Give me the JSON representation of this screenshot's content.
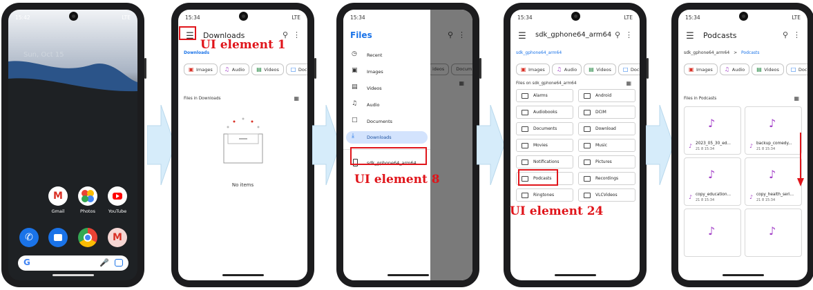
{
  "colors": {
    "annotation": "#e0141a",
    "accent": "#1a73e8",
    "music": "#a13dc7",
    "arrow": "#d6ecfa"
  },
  "phone1": {
    "time": "15:42",
    "signal": "LTE",
    "date": "Sun, Oct 15",
    "apps": [
      "Gmail",
      "Photos",
      "YouTube"
    ]
  },
  "phone2": {
    "time": "15:34",
    "signal": "LTE",
    "title": "Downloads",
    "breadcrumb": "Downloads",
    "chips": [
      "Images",
      "Audio",
      "Videos",
      "Docum"
    ],
    "section": "Files in Downloads",
    "empty": "No items",
    "annotation": "UI element 1"
  },
  "phone3": {
    "time": "15:34",
    "signal": "LTE",
    "drawer_title": "Files",
    "drawer_items": [
      "Recent",
      "Images",
      "Videos",
      "Audio",
      "Documents",
      "Downloads"
    ],
    "device": "sdk_gphone64_arm64",
    "bg_chips": [
      "ideos",
      "Docum"
    ],
    "annotation": "UI element 8"
  },
  "phone4": {
    "time": "15:34",
    "signal": "LTE",
    "title": "sdk_gphone64_arm64",
    "breadcrumb": "sdk_gphone64_arm64",
    "chips": [
      "Images",
      "Audio",
      "Videos",
      "Docum"
    ],
    "section": "Files on sdk_gphone64_arm64",
    "folders": [
      "Alarms",
      "Android",
      "Audiobooks",
      "DCIM",
      "Documents",
      "Download",
      "Movies",
      "Music",
      "Notifications",
      "Pictures",
      "Podcasts",
      "Recordings",
      "Ringtones",
      "VLCVideos"
    ],
    "annotation": "UI element 24"
  },
  "phone5": {
    "time": "15:34",
    "signal": "LTE",
    "title": "Podcasts",
    "crumb_root": "sdk_gphone64_arm64",
    "crumb_sep": ">",
    "crumb_current": "Podcasts",
    "chips": [
      "Images",
      "Audio",
      "Videos",
      "Docum"
    ],
    "section": "Files in Podcasts",
    "files": [
      {
        "name": "2023_05_30_ed...",
        "meta": "21 8 15:34"
      },
      {
        "name": "backup_comedy...",
        "meta": "21 8 15:34"
      },
      {
        "name": "copy_education...",
        "meta": "21 8 15:34"
      },
      {
        "name": "copy_health_seri...",
        "meta": "21 8 15:34"
      }
    ]
  }
}
